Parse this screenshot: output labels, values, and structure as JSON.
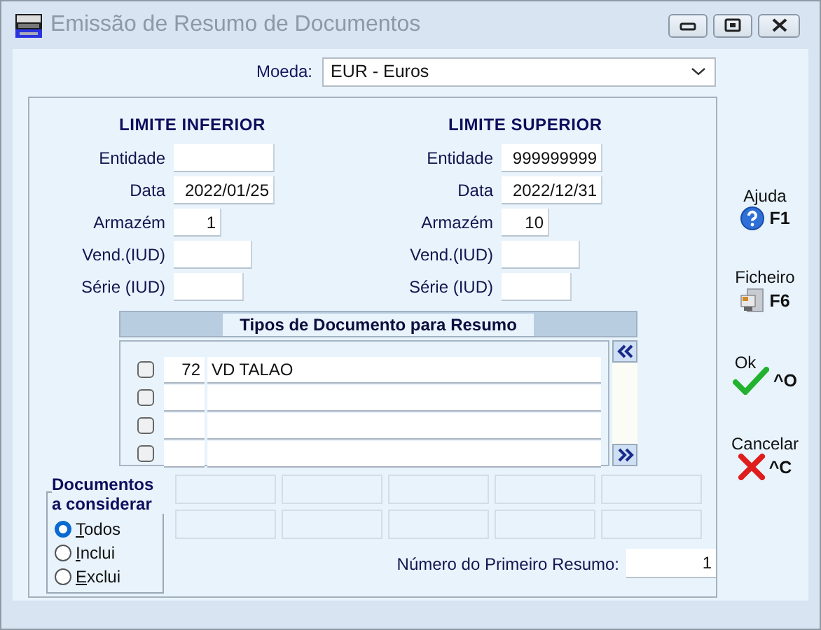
{
  "window": {
    "title": "Emissão de Resumo de Documentos"
  },
  "currency": {
    "label": "Moeda:",
    "value": "EUR - Euros"
  },
  "lower_limit": {
    "heading": "LIMITE INFERIOR",
    "fields": [
      {
        "label": "Entidade"
      },
      {
        "label": "Data",
        "value": "2022/01/25"
      },
      {
        "label": "Armazém",
        "value": "1"
      },
      {
        "label": "Vend.(IUD)"
      },
      {
        "label": "Série (IUD)"
      }
    ]
  },
  "upper_limit": {
    "heading": "LIMITE SUPERIOR",
    "fields": [
      {
        "label": "Entidade",
        "value": "999999999"
      },
      {
        "label": "Data",
        "value": "2022/12/31"
      },
      {
        "label": "Armazém",
        "value": "10"
      },
      {
        "label": "Vend.(IUD)"
      },
      {
        "label": "Série (IUD)"
      }
    ]
  },
  "document_types": {
    "title": "Tipos de Documento para Resumo",
    "rows": [
      {
        "checked": false,
        "code": "72",
        "description": "VD TALAO"
      },
      {
        "checked": false
      },
      {
        "checked": false
      },
      {
        "checked": false
      }
    ]
  },
  "documents_filter": {
    "title": "Documentos a considerar",
    "options": [
      {
        "label": "Todos",
        "selected": true
      },
      {
        "label": "Inclui",
        "selected": false
      },
      {
        "label": "Exclui",
        "selected": false
      }
    ]
  },
  "first_summary": {
    "label": "Número do Primeiro Resumo:",
    "value": "1"
  },
  "actions": [
    {
      "label": "Ajuda",
      "shortcut": "F1",
      "kind": "help"
    },
    {
      "label": "Ficheiro",
      "shortcut": "F6",
      "kind": "file"
    },
    {
      "label": "Ok",
      "shortcut": "^O",
      "kind": "ok"
    },
    {
      "label": "Cancelar",
      "shortcut": "^C",
      "kind": "cancel"
    }
  ]
}
